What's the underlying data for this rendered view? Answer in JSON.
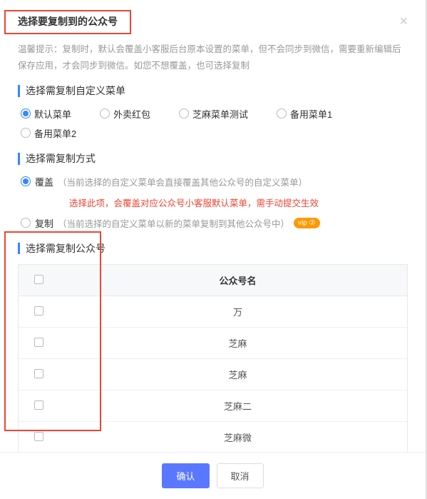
{
  "dialog": {
    "title": "选择要复制到的公众号",
    "hint": "温馨提示：复制时，默认会覆盖小客服后台原本设置的菜单，但不会同步到微信，需要重新编辑后保存应用，才会同步到微信。如您不想覆盖，也可选择复制"
  },
  "section1": {
    "title": "选择需复制自定义菜单",
    "options": [
      "默认菜单",
      "外卖红包",
      "芝麻菜单测试",
      "备用菜单1",
      "备用菜单2"
    ],
    "selected": 0
  },
  "section2": {
    "title": "选择需复制方式",
    "option1": {
      "label": "覆盖",
      "desc": "（当前选择的自定义菜单会直接覆盖其他公众号的自定义菜单）",
      "warning": "选择此项，会覆盖对应公众号小客服默认菜单，需手动提交生效"
    },
    "option2": {
      "label": "复制",
      "desc": "（当前选择的自定义菜单以新的菜单复制到其他公众号中）"
    },
    "selected": 0,
    "vip": "vip ②"
  },
  "section3": {
    "title": "选择需复制公众号",
    "header_col": "公众号名",
    "rows": [
      "万",
      "芝麻",
      "芝麻",
      "芝麻二",
      "芝麻微"
    ]
  },
  "footer": {
    "confirm": "确认",
    "cancel": "取消"
  }
}
